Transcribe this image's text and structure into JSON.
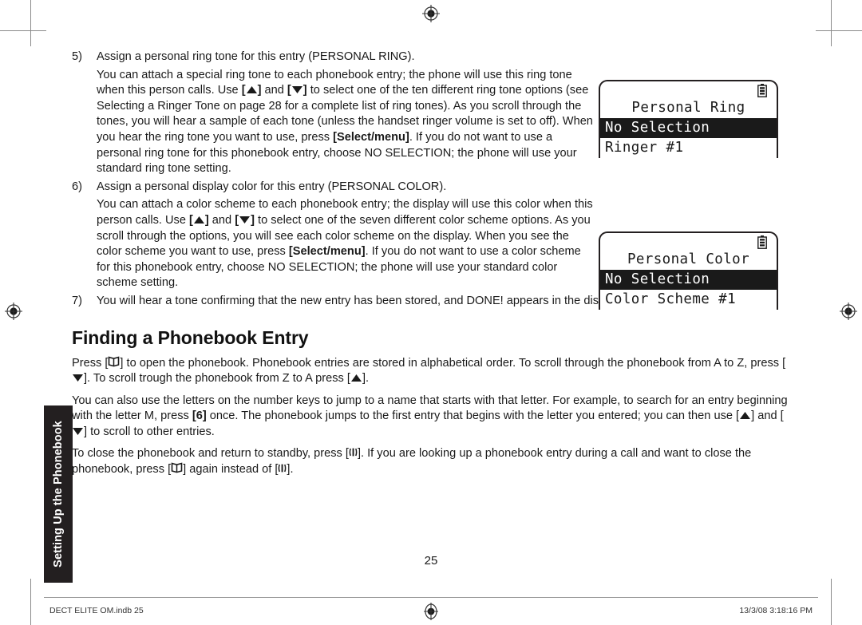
{
  "document": {
    "page_number": "25",
    "side_tab_label": "Setting Up the Phonebook",
    "section_title": "Finding a Phonebook Entry"
  },
  "steps": [
    {
      "num": "5)",
      "heading": "Assign a personal ring tone for this entry (PERSONAL RING).",
      "body_1": "You can attach a special ring tone to each phonebook entry; the phone will use this ring tone when this person calls. Use ",
      "body_2": " and ",
      "body_3": " to select one of the ten different ring tone options (see Selecting a Ringer Tone on page 28 for a complete list of ring tones). As you scroll through the tones, you will hear a sample of each tone (unless the handset ringer volume is set to off). When you hear the ring tone you want to use, press ",
      "bold_key": "[Select/menu]",
      "body_4": ". If you do not want to use a personal ring tone for this phonebook entry, choose NO SELECTION; the phone will use your standard ring tone setting."
    },
    {
      "num": "6)",
      "heading": "Assign a personal display color for this entry (PERSONAL COLOR).",
      "body_1": "You can attach a color scheme to each phonebook entry; the display will use this color when this person calls. Use ",
      "body_2": " and ",
      "body_3": " to select one of the seven different color scheme options. As you scroll through the options, you will see each color scheme on the display. When you see the color scheme you want to use, press ",
      "bold_key": "[Select/menu]",
      "body_4": ". If you do not want to use a color scheme for this phonebook entry, choose NO SELECTION; the phone will use your standard color scheme setting."
    },
    {
      "num": "7)",
      "heading": "You will hear a tone confirming that the new entry has been stored, and DONE! appears in the display."
    }
  ],
  "finding_section": {
    "para1_a": "Press [",
    "para1_b": "] to open the phonebook. Phonebook entries are stored in alphabetical order. To scroll through the phonebook from A to Z, press [",
    "para1_c": "]. To scroll trough the phonebook from Z to A press [",
    "para1_d": "].",
    "para2_a": "You can also use the letters on the number keys to jump to a name that starts with that letter. For example, to search for an entry beginning with the letter M, press ",
    "para2_key": "[6]",
    "para2_b": " once. The phonebook jumps to the first entry that begins with the letter you entered; you can then use [",
    "para2_c": "] and [",
    "para2_d": "] to scroll to other entries.",
    "para3_a": "To close the phonebook and return to standby, press [",
    "para3_b": "]. If you are looking up a phonebook entry during a call and want to close the phonebook, press [",
    "para3_c": "] again instead of [",
    "para3_d": "]."
  },
  "lcd_ring": {
    "title": "Personal Ring",
    "selected": "No Selection",
    "next": "Ringer #1",
    "battery_icon": "battery-icon"
  },
  "lcd_color": {
    "title": "Personal Color",
    "selected": "No Selection",
    "next": "Color Scheme #1",
    "battery_icon": "battery-icon"
  },
  "footer": {
    "left": "DECT ELITE OM.indb   25",
    "right": "13/3/08   3:18:16 PM"
  },
  "icons": {
    "up_arrow": "up-arrow-key-icon",
    "down_arrow": "down-arrow-key-icon",
    "phonebook": "phonebook-book-icon",
    "end_call": "end-call-key-icon",
    "registration": "registration-target-icon"
  },
  "colors": {
    "ink": "#1a1a1a",
    "tab_background": "#231f20",
    "crop_mark": "#8a8a8a"
  }
}
